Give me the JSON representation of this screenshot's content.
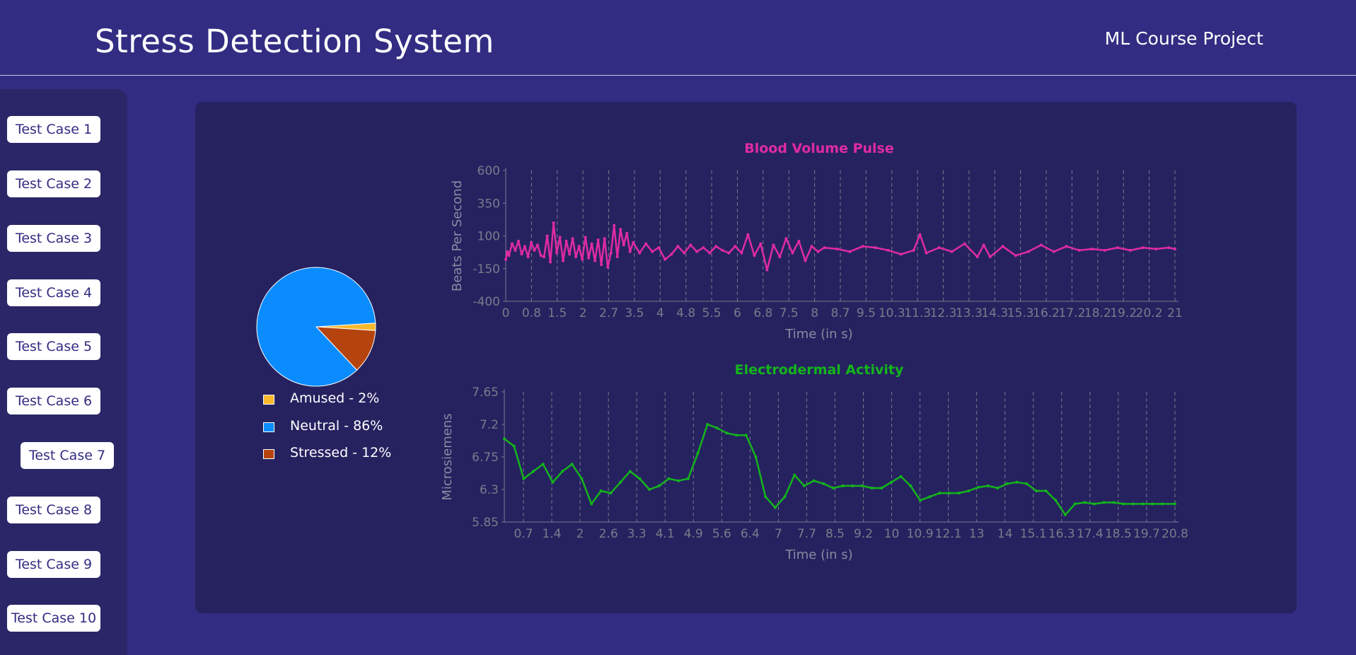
{
  "header": {
    "title": "Stress Detection System",
    "subtitle": "ML Course Project"
  },
  "sidebar": {
    "buttons": [
      {
        "label": "Test Case 1"
      },
      {
        "label": "Test Case 2"
      },
      {
        "label": "Test Case 3"
      },
      {
        "label": "Test Case 4"
      },
      {
        "label": "Test Case 5"
      },
      {
        "label": "Test Case 6"
      },
      {
        "label": "Test Case 7"
      },
      {
        "label": "Test Case 8"
      },
      {
        "label": "Test Case 9"
      },
      {
        "label": "Test Case 10"
      }
    ],
    "selected_index": 6
  },
  "legend": {
    "items": [
      {
        "label": "Amused - 2%",
        "color": "#f9b92d"
      },
      {
        "label": "Neutral - 86%",
        "color": "#0a8cff"
      },
      {
        "label": "Stressed - 12%",
        "color": "#b5430d"
      }
    ]
  },
  "chart_data": [
    {
      "type": "pie",
      "labels": [
        "Amused",
        "Neutral",
        "Stressed"
      ],
      "values": [
        2,
        86,
        12
      ],
      "colors": [
        "#f9b92d",
        "#0a8cff",
        "#b5430d"
      ],
      "legend_position": "bottom"
    },
    {
      "type": "line",
      "title": "Blood Volume Pulse",
      "xlabel": "Time (in s)",
      "ylabel": "Beats Per Second",
      "title_color": "#e02ba4",
      "line_color": "#e02ba4",
      "ylim": [
        -400,
        600
      ],
      "xlim": [
        0,
        21
      ],
      "x_ticks": [
        "0",
        "0.8",
        "1.5",
        "2",
        "2.7",
        "3.5",
        "4",
        "4.8",
        "5.5",
        "6",
        "6.8",
        "7.5",
        "8",
        "8.7",
        "9.5",
        "10.3",
        "11.3",
        "12.3",
        "13.3",
        "14.3",
        "15.3",
        "16.2",
        "17.2",
        "18.2",
        "19.2",
        "20.2",
        "21"
      ],
      "y_ticks": [
        "600",
        "350",
        "100",
        "-150",
        "-400"
      ],
      "grid": "vertical-dashed",
      "series": [
        {
          "x": [
            0,
            0.05,
            0.1,
            0.2,
            0.3,
            0.4,
            0.5,
            0.6,
            0.7,
            0.8,
            0.9,
            1,
            1.1,
            1.2,
            1.3,
            1.4,
            1.5,
            1.6,
            1.7,
            1.8,
            1.9,
            2,
            2.1,
            2.2,
            2.3,
            2.4,
            2.5,
            2.6,
            2.7,
            2.8,
            2.9,
            3,
            3.1,
            3.2,
            3.3,
            3.4,
            3.5,
            3.6,
            3.7,
            3.8,
            3.9,
            4,
            4.2,
            4.4,
            4.6,
            4.8,
            5,
            5.2,
            5.4,
            5.6,
            5.8,
            6,
            6.2,
            6.4,
            6.6,
            6.8,
            7,
            7.2,
            7.4,
            7.6,
            7.8,
            8,
            8.2,
            8.4,
            8.6,
            8.8,
            9,
            9.2,
            9.4,
            9.6,
            9.8,
            10,
            10.4,
            10.8,
            11.2,
            11.6,
            12,
            12.4,
            12.8,
            13,
            13.2,
            13.6,
            14,
            14.4,
            14.8,
            15,
            15.2,
            15.6,
            16,
            16.4,
            16.8,
            17.2,
            17.6,
            18,
            18.4,
            18.8,
            19.2,
            19.6,
            20,
            20.4,
            20.8,
            21
          ],
          "y": [
            -80,
            -20,
            -50,
            40,
            -10,
            60,
            -40,
            20,
            -60,
            50,
            -10,
            30,
            -50,
            -60,
            100,
            -100,
            200,
            -30,
            90,
            -90,
            60,
            -40,
            80,
            -60,
            20,
            -80,
            90,
            -70,
            40,
            -90,
            70,
            -120,
            80,
            -140,
            -30,
            180,
            -60,
            150,
            30,
            120,
            -20,
            50,
            -30,
            40,
            -20,
            10,
            -80,
            -40,
            20,
            -30,
            30,
            -20,
            10,
            -30,
            20,
            -10,
            -30,
            20,
            -30,
            110,
            -50,
            40,
            -160,
            30,
            -60,
            80,
            -30,
            60,
            -90,
            20,
            -20,
            10,
            0,
            -20,
            20,
            10,
            -10,
            -40,
            -10,
            110,
            -30,
            10,
            -20,
            40,
            -60,
            30,
            -60,
            20,
            -50,
            -20,
            30,
            -20,
            20,
            -10,
            0,
            -10,
            10,
            -10,
            10,
            0,
            10,
            0
          ]
        }
      ]
    },
    {
      "type": "line",
      "title": "Electrodermal Activity",
      "xlabel": "Time (in s)",
      "ylabel": "Microsiemens",
      "title_color": "#13b51a",
      "line_color": "#13b51a",
      "ylim": [
        5.85,
        7.65
      ],
      "xlim": [
        0,
        20.8
      ],
      "x_ticks": [
        "0.7",
        "1.4",
        "2",
        "2.6",
        "3.3",
        "4.1",
        "4.9",
        "5.6",
        "6.4",
        "7",
        "7.7",
        "8.5",
        "9.2",
        "10",
        "10.9",
        "12.1",
        "13",
        "14",
        "15.1",
        "16.3",
        "17.4",
        "18.5",
        "19.7",
        "20.8"
      ],
      "y_ticks": [
        "7.65",
        "7.2",
        "6.75",
        "6.3",
        "5.85"
      ],
      "grid": "vertical-dashed",
      "series": [
        {
          "x": [
            0,
            0.3,
            0.6,
            0.9,
            1.2,
            1.5,
            1.8,
            2.1,
            2.4,
            2.7,
            3,
            3.3,
            3.6,
            3.9,
            4.2,
            4.5,
            4.8,
            5.1,
            5.4,
            5.7,
            6,
            6.3,
            6.6,
            6.9,
            7.2,
            7.5,
            7.8,
            8.1,
            8.4,
            8.7,
            9,
            9.3,
            9.6,
            9.9,
            10.2,
            10.5,
            10.8,
            11.1,
            11.4,
            11.7,
            12,
            12.3,
            12.6,
            12.9,
            13.2,
            13.5,
            13.8,
            14.1,
            14.4,
            14.7,
            15,
            15.3,
            15.6,
            15.9,
            16.2,
            16.5,
            16.8,
            17.1,
            17.4,
            17.7,
            18,
            18.3,
            18.6,
            18.9,
            19.2,
            19.5,
            19.8,
            20.1,
            20.4,
            20.8
          ],
          "y": [
            7.0,
            6.9,
            6.45,
            6.55,
            6.65,
            6.4,
            6.55,
            6.65,
            6.45,
            6.1,
            6.28,
            6.25,
            6.4,
            6.55,
            6.45,
            6.3,
            6.35,
            6.45,
            6.42,
            6.45,
            6.8,
            7.2,
            7.15,
            7.08,
            7.05,
            7.05,
            6.75,
            6.2,
            6.05,
            6.2,
            6.5,
            6.35,
            6.42,
            6.38,
            6.32,
            6.35,
            6.35,
            6.35,
            6.32,
            6.32,
            6.4,
            6.48,
            6.35,
            6.15,
            6.2,
            6.25,
            6.25,
            6.25,
            6.28,
            6.33,
            6.35,
            6.32,
            6.38,
            6.4,
            6.38,
            6.28,
            6.28,
            6.15,
            5.95,
            6.1,
            6.12,
            6.1,
            6.12,
            6.12,
            6.1,
            6.1,
            6.1,
            6.1,
            6.1,
            6.1
          ]
        }
      ]
    }
  ]
}
